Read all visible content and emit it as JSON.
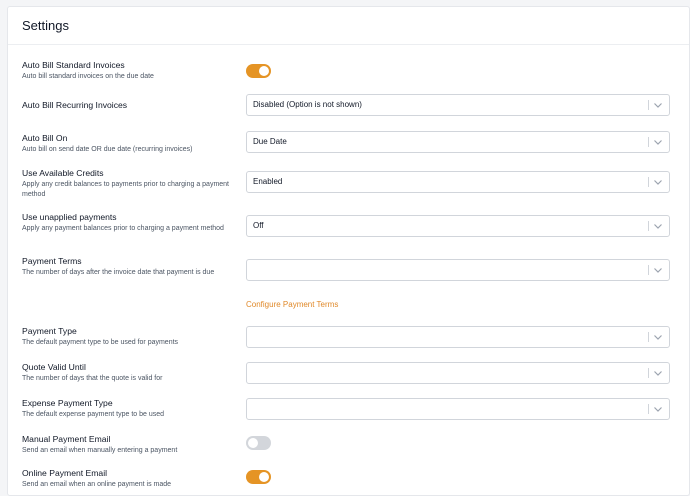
{
  "settings_title": "Settings",
  "accent_color": "#e59425",
  "rows": [
    {
      "label": "Auto Bill Standard Invoices",
      "desc": "Auto bill standard invoices on the due date",
      "toggle": "on"
    },
    {
      "label": "Auto Bill Recurring Invoices",
      "desc": "",
      "value": "Disabled (Option is not shown)"
    },
    {
      "label": "Auto Bill On",
      "desc": "Auto bill on send date OR due date (recurring invoices)",
      "value": "Due Date"
    },
    {
      "label": "Use Available Credits",
      "desc": "Apply any credit balances to payments prior to charging a payment method",
      "value": "Enabled"
    },
    {
      "label": "Use unapplied payments",
      "desc": "Apply any payment balances prior to charging a payment method",
      "value": "Off"
    },
    {
      "label": "Payment Terms",
      "desc": "The number of days after the invoice date that payment is due",
      "value": ""
    },
    {
      "label": "Payment Type",
      "desc": "The default payment type to be used for payments",
      "value": ""
    },
    {
      "label": "Quote Valid Until",
      "desc": "The number of days that the quote is valid for",
      "value": ""
    },
    {
      "label": "Expense Payment Type",
      "desc": "The default expense payment type to be used",
      "value": ""
    },
    {
      "label": "Manual Payment Email",
      "desc": "Send an email when manually entering a payment",
      "toggle": "off"
    },
    {
      "label": "Online Payment Email",
      "desc": "Send an email when an online payment is made",
      "toggle": "on"
    }
  ],
  "configure_payment_terms_link": "Configure Payment Terms",
  "icons": {
    "select_chevron": "chevron-down-icon"
  }
}
